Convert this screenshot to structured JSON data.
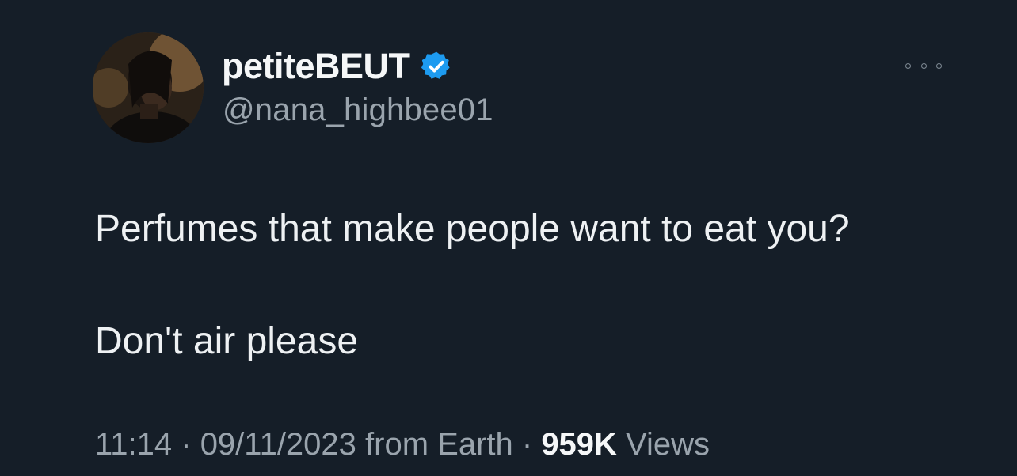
{
  "author": {
    "display_name": "petiteBEUT",
    "handle": "@nana_highbee01",
    "verified": true,
    "verified_badge_color": "#1d9bf0",
    "avatar_icon": "profile-photo"
  },
  "tweet": {
    "line1": "Perfumes that make people want to eat you?",
    "line2": "Don't air please"
  },
  "meta": {
    "time": "11:14",
    "separator1": " · ",
    "date": "09/11/2023",
    "source": " from Earth",
    "separator2": " · ",
    "views_count": "959K",
    "views_label": " Views"
  },
  "menu": {
    "icon": "more-options-icon"
  },
  "colors": {
    "background": "#151e28",
    "primary_text": "#eef1f3",
    "secondary_text": "#9aa4ad"
  }
}
